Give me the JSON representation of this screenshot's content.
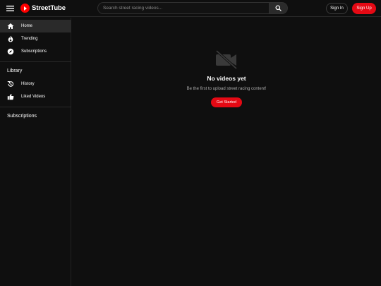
{
  "header": {
    "brand": "StreetTube",
    "search_placeholder": "Search street racing videos...",
    "signin_label": "Sign In",
    "signup_label": "Sign Up"
  },
  "sidebar": {
    "items": [
      {
        "label": "Home",
        "icon": "home-icon",
        "active": true
      },
      {
        "label": "Trending",
        "icon": "fire-icon"
      },
      {
        "label": "Subscriptions",
        "icon": "compass-icon"
      }
    ],
    "library_title": "Library",
    "library_items": [
      {
        "label": "History",
        "icon": "history-icon"
      },
      {
        "label": "Liked Videos",
        "icon": "thumbs-up-icon"
      }
    ],
    "subscriptions_title": "Subscriptions"
  },
  "main": {
    "empty_icon": "video-off-icon",
    "empty_title": "No videos yet",
    "empty_subtitle": "Be the first to upload street racing content!",
    "cta_label": "Get Started"
  },
  "colors": {
    "background": "#0f0f0f",
    "accent": "#e50914",
    "brand_red": "#ff0000",
    "active_item": "#2a2a2a"
  }
}
